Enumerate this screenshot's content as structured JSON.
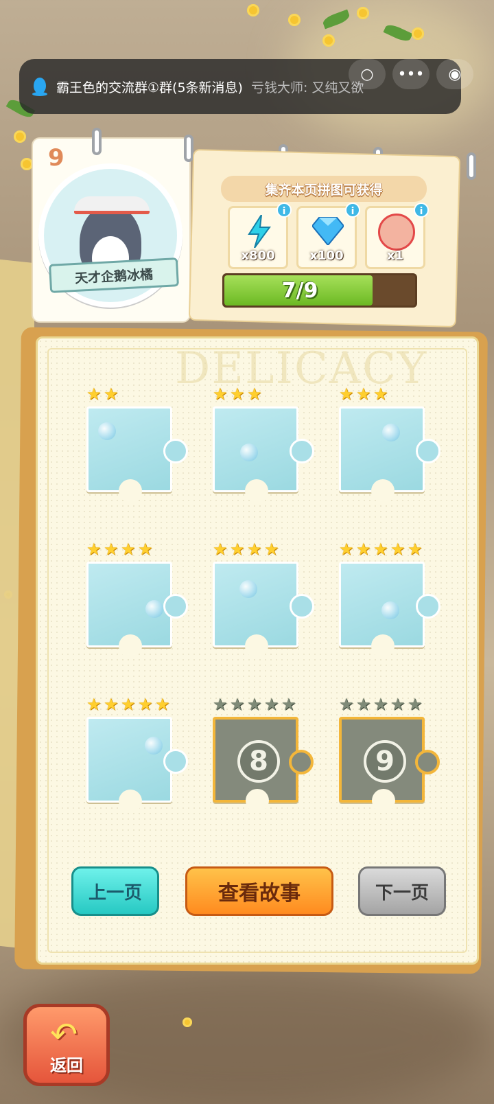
{
  "notification": {
    "group_text": "霸王色的交流群①群(5条新消息)",
    "sender_text": "亏钱大师: 又纯又欲"
  },
  "album": {
    "page_number": "9",
    "badge_title": "天才企鹅冰橘",
    "watermark": "DELICACY"
  },
  "rewards": {
    "title": "集齐本页拼图可获得",
    "items": [
      {
        "icon": "lightning-icon",
        "qty": "x800"
      },
      {
        "icon": "diamond-icon",
        "qty": "x100"
      },
      {
        "icon": "character-icon",
        "qty": "x1"
      }
    ],
    "info_glyph": "i"
  },
  "progress": {
    "text": "7/9",
    "collected": 7,
    "total": 9
  },
  "pieces": [
    {
      "stars": 2,
      "max_stars": 2,
      "locked": false,
      "number": ""
    },
    {
      "stars": 3,
      "max_stars": 3,
      "locked": false,
      "number": ""
    },
    {
      "stars": 3,
      "max_stars": 3,
      "locked": false,
      "number": ""
    },
    {
      "stars": 4,
      "max_stars": 4,
      "locked": false,
      "number": ""
    },
    {
      "stars": 4,
      "max_stars": 4,
      "locked": false,
      "number": ""
    },
    {
      "stars": 5,
      "max_stars": 5,
      "locked": false,
      "number": ""
    },
    {
      "stars": 5,
      "max_stars": 5,
      "locked": false,
      "number": ""
    },
    {
      "stars": 0,
      "max_stars": 5,
      "locked": true,
      "number": "8"
    },
    {
      "stars": 0,
      "max_stars": 5,
      "locked": true,
      "number": "9"
    }
  ],
  "buttons": {
    "prev": "上一页",
    "story": "查看故事",
    "next": "下一页",
    "back": "返回"
  },
  "colors": {
    "star_on": "#ffcf2e",
    "star_off": "#7f8b78",
    "progress_fill": "#6cb923",
    "locked_border": "#f3b63a"
  }
}
